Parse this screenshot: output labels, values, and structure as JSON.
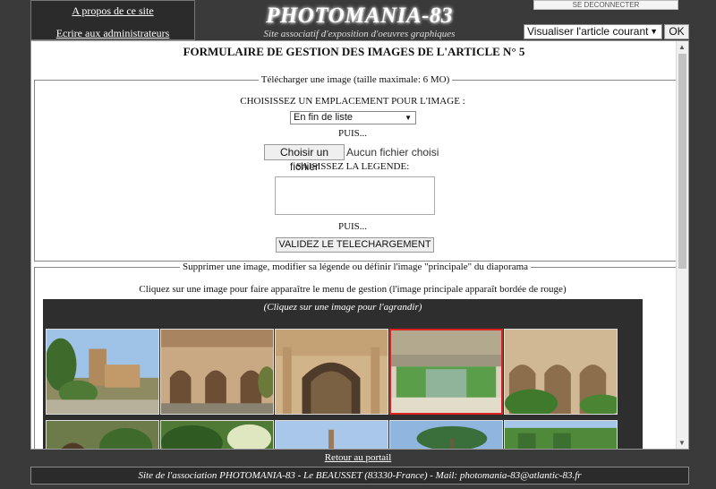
{
  "header": {
    "link_about": "A propos de ce site",
    "link_write": "Ecrire aux administrateurs",
    "site_title": "PHOTOMANIA-83",
    "site_subtitle": "Site associatif d'exposition d'oeuvres graphiques",
    "logout_label": "SE DECONNECTER",
    "view_select_value": "Visualiser l'article courant",
    "ok_label": "OK"
  },
  "form": {
    "title": "FORMULAIRE DE GESTION DES IMAGES DE L'ARTICLE N° 5",
    "upload": {
      "legend": "Télécharger une image (taille maximale: 6 MO)",
      "choose_location": "CHOISISSEZ UN EMPLACEMENT POUR L'IMAGE :",
      "location_value": "En fin de liste",
      "then1": "PUIS...",
      "choose_file": "Choisir un fichier",
      "no_file": "Aucun fichier choisi",
      "enter_caption": "SAISISSEZ LA LEGENDE:",
      "caption_value": "",
      "then2": "PUIS...",
      "submit": "VALIDEZ LE TELECHARGEMENT"
    },
    "manage": {
      "legend": "Supprimer une image, modifier sa légende ou définir l'image \"principale\" du diaporama",
      "instruction": "Cliquez sur une image pour faire apparaître le menu de gestion (l'image principale apparaît bordée de rouge)",
      "gallery_caption": "(Cliquez sur une image pour l'agrandir)"
    }
  },
  "colors": {
    "main_image_border": "#dd2222"
  },
  "footer": {
    "return_link": "Retour au portail",
    "text": "Site de l'association PHOTOMANIA-83 - Le BEAUSSET (83330-France) - Mail: photomania-83@atlantic-83.fr"
  }
}
